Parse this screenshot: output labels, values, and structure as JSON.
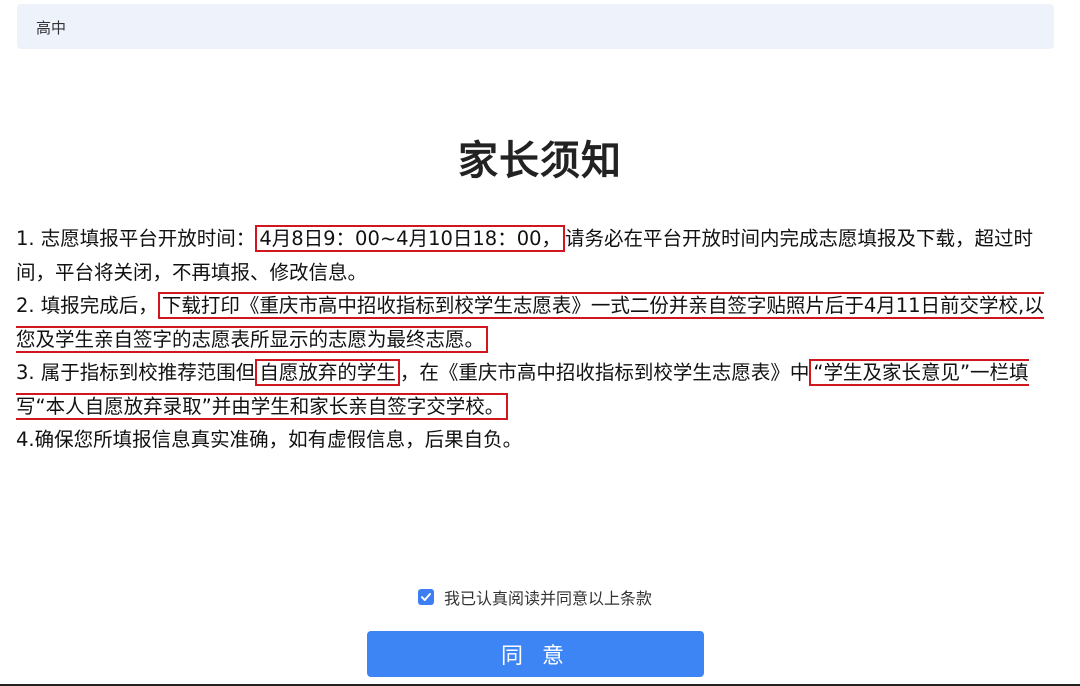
{
  "header": {
    "breadcrumb": "高中"
  },
  "notice": {
    "title": "家长须知",
    "item1_prefix": "1. 志愿填报平台开放时间：",
    "item1_highlight": "4月8日9：00~4月10日18：00，",
    "item1_suffix": "请务必在平台开放时间内完成志愿填报及下载，超过时间，平台将关闭，不再填报、修改信息。",
    "item2_prefix": "2. 填报完成后，",
    "item2_highlight": "下载打印《重庆市高中招收指标到校学生志愿表》一式二份并亲自签字贴照片后于4月11日前交学校,以您及学生亲自签字的志愿表所显示的志愿为最终志愿。",
    "item3_prefix": "3. 属于指标到校推荐范围但",
    "item3_highlight1": "自愿放弃的学生",
    "item3_middle": "，在《重庆市高中招收指标到校学生志愿表》中",
    "item3_highlight2": "“学生及家长意见”一栏填写“本人自愿放弃录取”并由学生和家长亲自签字交学校。",
    "item4": "4.确保您所填报信息真实准确，如有虚假信息，后果自负。"
  },
  "agreement": {
    "checkbox_label": "我已认真阅读并同意以上条款",
    "checked": true,
    "accent_color": "#3d84f4"
  },
  "actions": {
    "agree_label": "同 意"
  }
}
